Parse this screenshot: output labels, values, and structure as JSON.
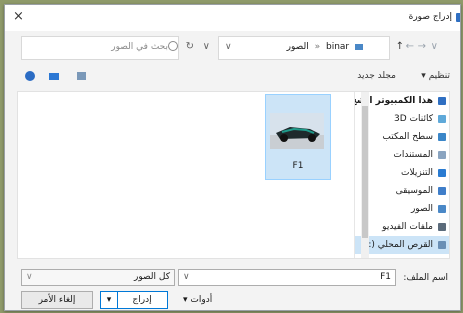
{
  "dialog": {
    "title": "إدراج صورة",
    "close_glyph": "×",
    "icons": {
      "app": "insert-picture-icon",
      "close": "close-icon"
    }
  },
  "address": {
    "path": [
      "binar",
      "الصور"
    ],
    "separator": "«",
    "search_placeholder": "بحث في الصور",
    "nav_back": "←",
    "nav_forward": "→",
    "nav_up": "↑",
    "dropdown_glyph": "∨",
    "refresh_glyph": "↻"
  },
  "toolbar": {
    "organize": "تنظيم",
    "organize_caret": "▾",
    "new_folder": "مجلد جديد"
  },
  "tree": [
    {
      "label": "هذا الكمبيوتر الشخ",
      "icon": "this-pc-icon",
      "color": "#2f6fc2",
      "top": true
    },
    {
      "label": "كائنات 3D",
      "icon": "3d-objects-icon",
      "color": "#5fa9d9"
    },
    {
      "label": "سطح المكتب",
      "icon": "desktop-icon",
      "color": "#3a86c8"
    },
    {
      "label": "المستندات",
      "icon": "documents-icon",
      "color": "#8aa4c0"
    },
    {
      "label": "التنزيلات",
      "icon": "downloads-icon",
      "color": "#2a7bd1"
    },
    {
      "label": "الموسيقى",
      "icon": "music-icon",
      "color": "#3f7ec9"
    },
    {
      "label": "الصور",
      "icon": "pictures-icon",
      "color": "#4a88c7"
    },
    {
      "label": "ملفات الفيديو",
      "icon": "videos-icon",
      "color": "#5b6b7b"
    },
    {
      "label": "القرص المحلي (:",
      "icon": "local-disk-icon",
      "color": "#6a8fb5",
      "selected": true
    }
  ],
  "files": [
    {
      "name": "F1",
      "icon": "image-thumbnail-icon"
    }
  ],
  "bottom": {
    "filename_label": "اسم الملف:",
    "filename_value": "F1",
    "filetype_value": "كل الصور",
    "tools_label": "أدوات",
    "insert_label": "إدراج",
    "cancel_label": "إلغاء الأمر",
    "caret": "▾"
  }
}
